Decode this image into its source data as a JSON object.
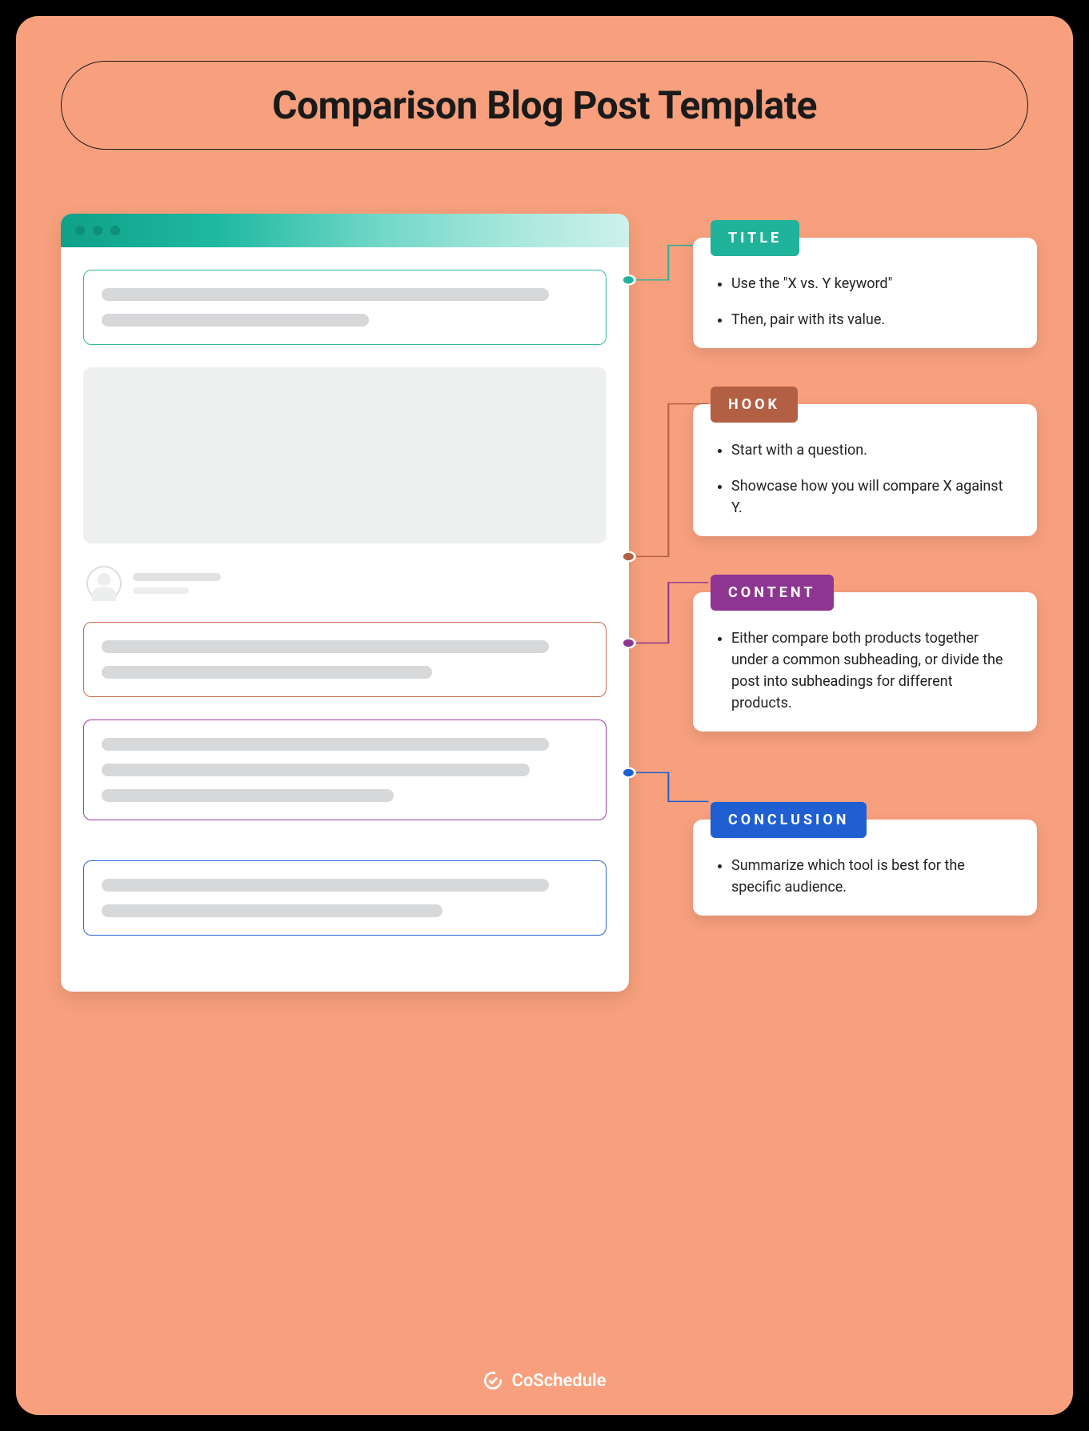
{
  "header": {
    "title": "Comparison Blog Post Template"
  },
  "callouts": {
    "title": {
      "label": "TITLE",
      "items": [
        "Use the \"X vs. Y keyword\"",
        "Then, pair with its value."
      ]
    },
    "hook": {
      "label": "HOOK",
      "items": [
        "Start with a question.",
        "Showcase how you will compare X against Y."
      ]
    },
    "content": {
      "label": "CONTENT",
      "items": [
        "Either compare both products together under a common subheading, or divide the post into subheadings for different products."
      ]
    },
    "conclusion": {
      "label": "CONCLUSION",
      "items": [
        "Summarize which tool is best for the specific audience."
      ]
    }
  },
  "footer": {
    "brand": "CoSchedule"
  },
  "colors": {
    "bg": "#f8a07d",
    "title_accent": "#21b29b",
    "hook_accent": "#b35f44",
    "content_accent": "#8e3591",
    "conclusion_accent": "#1f5fd2"
  }
}
